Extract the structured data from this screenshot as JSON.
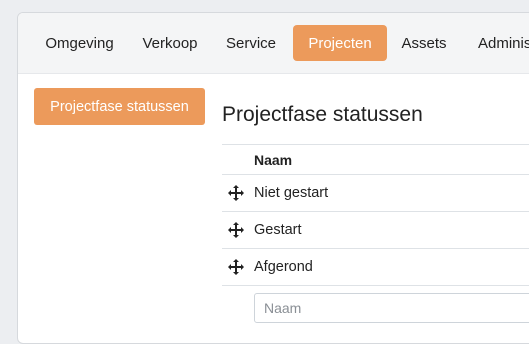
{
  "nav": {
    "items": [
      {
        "label": "Omgeving",
        "active": false
      },
      {
        "label": "Verkoop",
        "active": false
      },
      {
        "label": "Service",
        "active": false
      },
      {
        "label": "Projecten",
        "active": true
      },
      {
        "label": "Assets",
        "active": false
      },
      {
        "label": "Administ",
        "active": false
      }
    ]
  },
  "sidebar": {
    "button_label": "Projectfase statussen"
  },
  "main": {
    "title": "Projectfase statussen",
    "table": {
      "column_header": "Naam",
      "rows": [
        {
          "name": "Niet gestart",
          "icon": "move-icon"
        },
        {
          "name": "Gestart",
          "icon": "move-icon"
        },
        {
          "name": "Afgerond",
          "icon": "move-icon"
        }
      ],
      "new_row_placeholder": "Naam"
    }
  },
  "colors": {
    "accent": "#ec9a5b",
    "nav_bg": "#f4f5f6"
  }
}
